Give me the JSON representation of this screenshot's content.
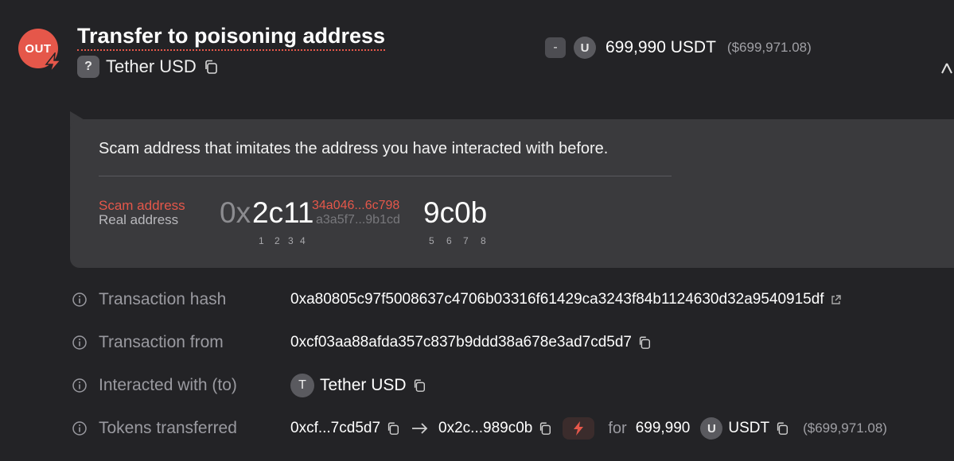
{
  "header": {
    "direction_badge": "OUT",
    "title": "Transfer to poisoning address",
    "token_badge": "?",
    "token_name": "Tether USD",
    "amount_sign": "-",
    "amount_token_badge": "U",
    "amount": "699,990 USDT",
    "amount_usd": "($699,971.08)"
  },
  "warning": {
    "message": "Scam address that imitates the address you have interacted with before.",
    "scam_label": "Scam address",
    "real_label": "Real address",
    "prefix": "0x",
    "head": "2c11",
    "scam_middle": "34a046...6c798",
    "real_middle": "a3a5f7...9b1cd",
    "tail": "9c0b",
    "digit_numbers": [
      "1",
      "2",
      "3",
      "4",
      "5",
      "6",
      "7",
      "8"
    ]
  },
  "details": {
    "tx_hash_label": "Transaction hash",
    "tx_hash": "0xa80805c97f5008637c4706b03316f61429ca3243f84b1124630d32a9540915df",
    "tx_from_label": "Transaction from",
    "tx_from": "0xcf03aa88afda357c837b9ddd38a678e3ad7cd5d7",
    "interacted_label": "Interacted with (to)",
    "interacted_badge": "T",
    "interacted_name": "Tether USD",
    "tokens_label": "Tokens transferred",
    "from_short": "0xcf...7cd5d7",
    "to_short": "0x2c...989c0b",
    "for_text": "for",
    "token_amount": "699,990",
    "token_badge": "U",
    "token_symbol": "USDT",
    "token_usd": "($699,971.08)"
  },
  "colors": {
    "background": "#232326",
    "panel": "#3a3a3d",
    "danger": "#e5574a",
    "muted": "#9a9aa0"
  }
}
